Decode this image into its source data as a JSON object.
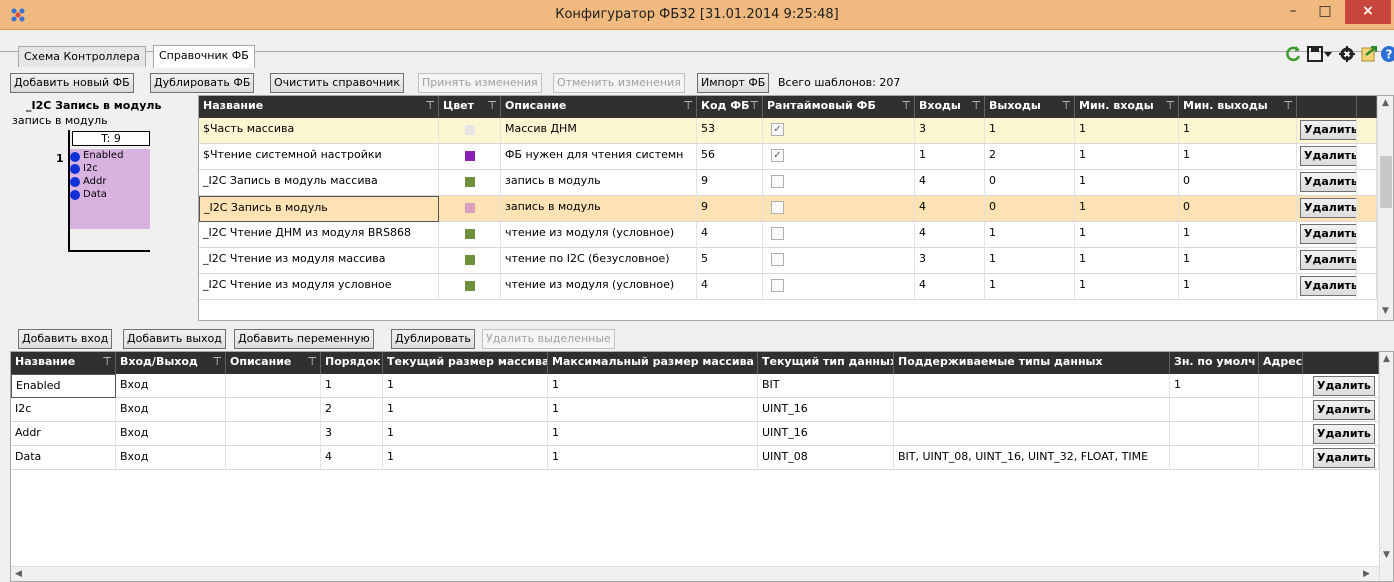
{
  "window": {
    "title": "Конфигуратор ФБ32 [31.01.2014 9:25:48]",
    "min_label": "–",
    "max_label": "□",
    "close_label": "×"
  },
  "tabs": [
    {
      "label": "Схема Контроллера",
      "active": false
    },
    {
      "label": "Справочник ФБ",
      "active": true
    }
  ],
  "toolbar_icons": [
    "refresh-icon",
    "save-icon",
    "dropdown-arrow-icon",
    "settings-icon",
    "export-icon",
    "help-icon"
  ],
  "toolbar": {
    "add_fb": "Добавить новый ФБ",
    "duplicate_fb": "Дублировать ФБ",
    "clear_ref": "Очистить справочник",
    "accept": "Принять изменения",
    "cancel": "Отменить изменения",
    "import_fb": "Импорт ФБ",
    "total_templates": "Всего шаблонов: 207"
  },
  "preview": {
    "title": "_I2C Запись в модуль",
    "subtitle": "запись в модуль",
    "code": "T: 9",
    "index": "1",
    "ports": [
      "Enabled",
      "I2c",
      "Addr",
      "Data"
    ],
    "block_color": "#d9b3e0"
  },
  "fb_table": {
    "columns": [
      "Название",
      "Цвет",
      "Описание",
      "Код ФБ",
      "Рантаймовый ФБ",
      "Входы",
      "Выходы",
      "Мин. входы",
      "Мин. выходы"
    ],
    "delete_label": "Удалить",
    "rows": [
      {
        "name": "$Часть массива",
        "color": "#e6e6e6",
        "desc": "Массив ДНМ",
        "code": "53",
        "runtime": true,
        "in": "3",
        "out": "1",
        "min_in": "1",
        "min_out": "1",
        "state": "highlight"
      },
      {
        "name": "$Чтение системной настройки",
        "color": "#8a1fb5",
        "desc": "ФБ нужен для чтения системн",
        "code": "56",
        "runtime": true,
        "in": "1",
        "out": "2",
        "min_in": "1",
        "min_out": "1",
        "state": "normal"
      },
      {
        "name": "_I2C Запись в модуль массива",
        "color": "#6e8f3c",
        "desc": "запись в модуль",
        "code": "9",
        "runtime": false,
        "in": "4",
        "out": "0",
        "min_in": "1",
        "min_out": "0",
        "state": "normal"
      },
      {
        "name": "_I2C Запись в модуль",
        "color": "#d9a0bd",
        "desc": "запись в модуль",
        "code": "9",
        "runtime": false,
        "in": "4",
        "out": "0",
        "min_in": "1",
        "min_out": "0",
        "state": "selected"
      },
      {
        "name": "_I2C Чтение ДНМ из модуля BRS868",
        "color": "#6e8f3c",
        "desc": "чтение из модуля (условное)",
        "code": "4",
        "runtime": false,
        "in": "4",
        "out": "1",
        "min_in": "1",
        "min_out": "1",
        "state": "normal"
      },
      {
        "name": "_I2C Чтение из модуля массива",
        "color": "#6e8f3c",
        "desc": "чтение по I2C (безусловное)",
        "code": "5",
        "runtime": false,
        "in": "3",
        "out": "1",
        "min_in": "1",
        "min_out": "1",
        "state": "normal"
      },
      {
        "name": "_I2C Чтение из модуля условное",
        "color": "#6e8f3c",
        "desc": "чтение из модуля (условное)",
        "code": "4",
        "runtime": false,
        "in": "4",
        "out": "1",
        "min_in": "1",
        "min_out": "1",
        "state": "normal"
      }
    ]
  },
  "vars_toolbar": {
    "add_input": "Добавить вход",
    "add_output": "Добавить выход",
    "add_var": "Добавить переменную",
    "duplicate": "Дублировать",
    "delete_selected": "Удалить выделенные"
  },
  "vars_table": {
    "columns": [
      "Название",
      "Вход/Выход",
      "Описание",
      "Порядок",
      "Текущий размер массива",
      "Максимальный размер массива",
      "Текущий тип данных",
      "Поддерживаемые типы данных",
      "Зн. по умолч",
      "Адрес"
    ],
    "delete_label": "Удалить",
    "rows": [
      {
        "name": "Enabled",
        "io": "Вход",
        "desc": "",
        "order": "1",
        "cur_size": "1",
        "max_size": "1",
        "type": "BIT",
        "supported": "",
        "default": "1",
        "addr": ""
      },
      {
        "name": "I2c",
        "io": "Вход",
        "desc": "",
        "order": "2",
        "cur_size": "1",
        "max_size": "1",
        "type": "UINT_16",
        "supported": "",
        "default": "",
        "addr": ""
      },
      {
        "name": "Addr",
        "io": "Вход",
        "desc": "",
        "order": "3",
        "cur_size": "1",
        "max_size": "1",
        "type": "UINT_16",
        "supported": "",
        "default": "",
        "addr": ""
      },
      {
        "name": "Data",
        "io": "Вход",
        "desc": "",
        "order": "4",
        "cur_size": "1",
        "max_size": "1",
        "type": "UINT_08",
        "supported": "BIT, UINT_08, UINT_16, UINT_32, FLOAT, TIME",
        "default": "",
        "addr": ""
      }
    ]
  },
  "colors": {
    "titlebar": "#f0b97f",
    "header": "#303030",
    "row_highlight": "#fdf6d2",
    "row_selected": "#fde2b4",
    "close": "#c7453a"
  }
}
